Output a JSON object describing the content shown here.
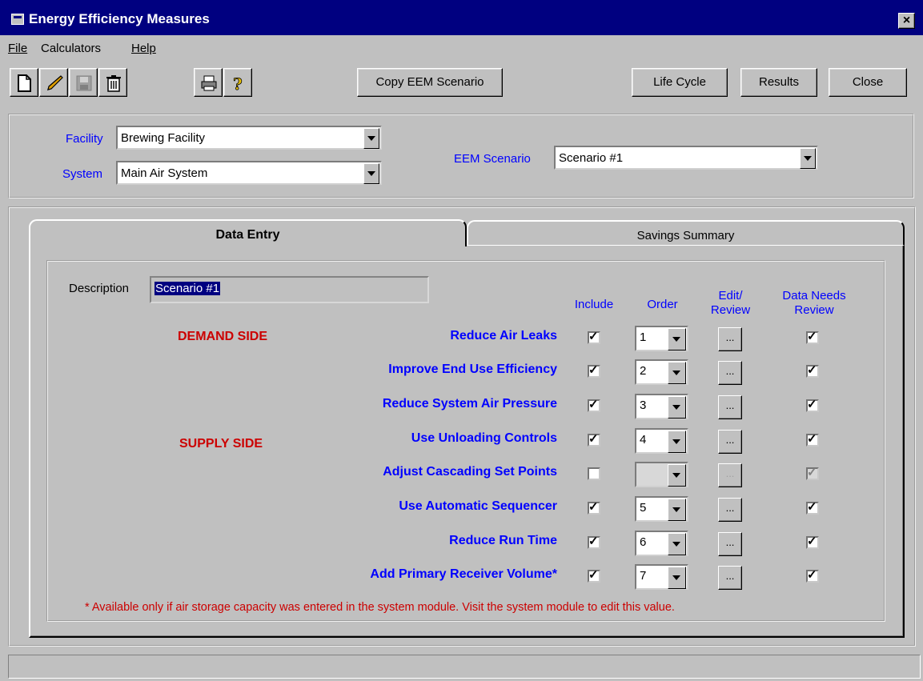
{
  "window": {
    "title": "Energy Efficiency Measures",
    "close_glyph": "×"
  },
  "menu": {
    "file": "File",
    "calculators": "Calculators",
    "help": "Help"
  },
  "toolbar": {
    "icons": [
      "new-icon",
      "edit-pencil-icon",
      "save-icon",
      "delete-trash-icon",
      "print-icon",
      "help-question-icon"
    ],
    "copy_scenario": "Copy EEM Scenario",
    "life_cycle": "Life Cycle",
    "results": "Results",
    "close": "Close"
  },
  "filters": {
    "facility_label": "Facility",
    "facility_value": "Brewing Facility",
    "system_label": "System",
    "system_value": "Main Air System",
    "scenario_label": "EEM Scenario",
    "scenario_value": "Scenario #1"
  },
  "tabs": [
    {
      "label": "Data Entry",
      "active": true
    },
    {
      "label": "Savings Summary",
      "active": false
    }
  ],
  "description": {
    "label": "Description",
    "value": "Scenario #1"
  },
  "columns": {
    "include": "Include",
    "order": "Order",
    "edit_review_1": "Edit/",
    "edit_review_2": "Review",
    "data_review_1": "Data Needs",
    "data_review_2": "Review"
  },
  "sections": {
    "demand": "DEMAND SIDE",
    "supply": "SUPPLY SIDE"
  },
  "measures": [
    {
      "name": "Reduce Air Leaks",
      "include": true,
      "order": "1",
      "edit": "...",
      "needs_review": true,
      "enabled": true
    },
    {
      "name": "Improve End Use Efficiency",
      "include": true,
      "order": "2",
      "edit": "...",
      "needs_review": true,
      "enabled": true
    },
    {
      "name": "Reduce System Air Pressure",
      "include": true,
      "order": "3",
      "edit": "...",
      "needs_review": true,
      "enabled": true
    },
    {
      "name": "Use Unloading Controls",
      "include": true,
      "order": "4",
      "edit": "...",
      "needs_review": true,
      "enabled": true
    },
    {
      "name": "Adjust Cascading Set Points",
      "include": false,
      "order": "",
      "edit": "...",
      "needs_review": true,
      "enabled": false
    },
    {
      "name": "Use Automatic Sequencer",
      "include": true,
      "order": "5",
      "edit": "...",
      "needs_review": true,
      "enabled": true
    },
    {
      "name": "Reduce Run Time",
      "include": true,
      "order": "6",
      "edit": "...",
      "needs_review": true,
      "enabled": true
    },
    {
      "name": "Add Primary Receiver Volume*",
      "include": true,
      "order": "7",
      "edit": "...",
      "needs_review": true,
      "enabled": true
    }
  ],
  "check_glyph": "✓",
  "footnote": "* Available only if air storage capacity was entered in the system module.  Visit the system module to edit this value.",
  "status": ""
}
